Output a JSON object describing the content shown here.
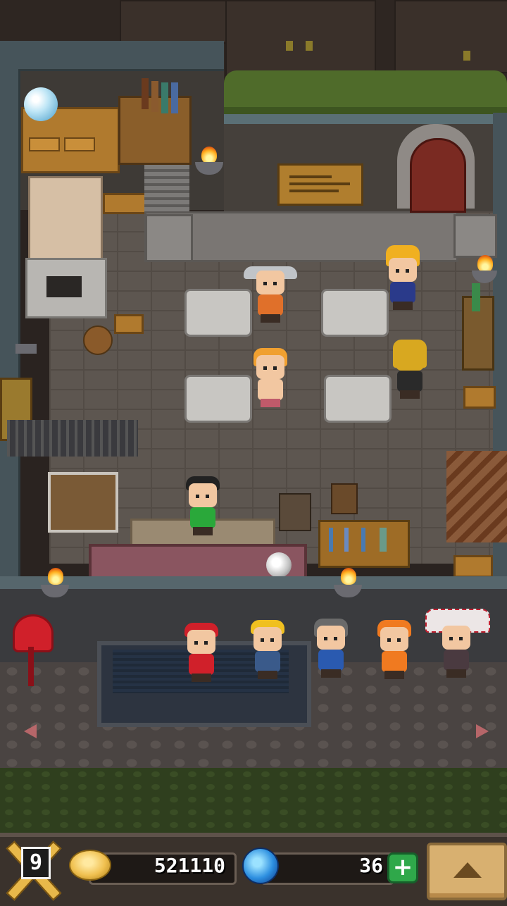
{
  "hud": {
    "level": "9",
    "gold": "521110",
    "gems": "36",
    "add_gems_label": "+"
  },
  "icons": {
    "level_badge": "crossed-swords-icon",
    "gold": "gold-coin-icon",
    "gems": "blue-gem-icon",
    "add_gems": "plus-icon",
    "menu": "triangle-up-icon"
  },
  "colors": {
    "hud_bg": "#3a322c",
    "gold": "#f0c050",
    "gem": "#2d8fe0",
    "plus_button": "#2fa84a",
    "menu_button": "#d8b070"
  }
}
